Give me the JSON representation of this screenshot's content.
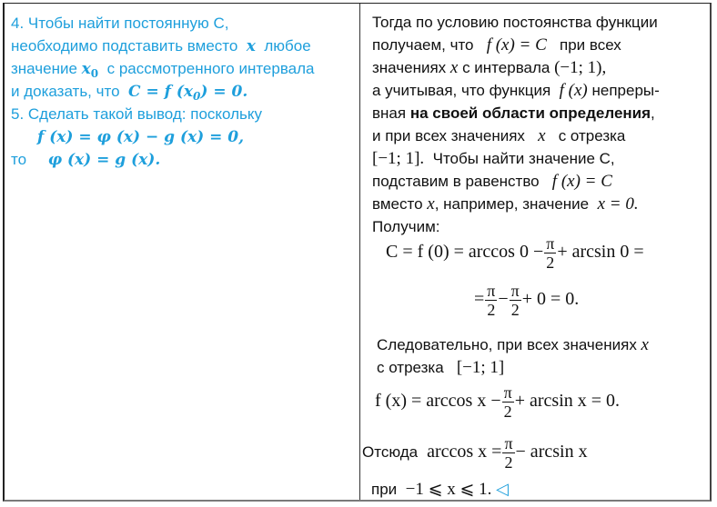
{
  "left_column": {
    "step4_line1": "4. Чтобы найти постоянную С,",
    "step4_line2_text": "необходимо подставить вместо",
    "step4_line2_var": "x",
    "step4_line2_end": "любое",
    "step4_line3_text": "значение",
    "step4_line3_var": "x",
    "step4_line3_sub": "0",
    "step4_line3_end": "с рассмотренного интервала",
    "step4_line4_text": "и доказать, что",
    "step4_line4_formula_pre": "C = f (x",
    "step4_line4_formula_sub": "0",
    "step4_line4_formula_post": ") = 0.",
    "step5_line1": "5. Сделать такой вывод: поскольку",
    "step5_formula1": "f (x) = φ (x) − g (x) = 0,",
    "step5_line3_text": "то",
    "step5_formula2": "φ (x) = g (x).",
    "text_color": "#1e9fdc"
  },
  "right_column": {
    "l1": "Тогда по условию постоянства функции",
    "l2_text": "получаем, что",
    "l2_formula": "f (x) = C",
    "l2_end": "при всех",
    "l3_text": "значениях",
    "l3_var": "x",
    "l3_mid": "с интервала",
    "l3_formula": "(−1;   1),",
    "l4_text": "а учитывая, что функция",
    "l4_formula": "f (x)",
    "l4_end": "непреры-",
    "l5_text": "вная",
    "l5_bold": "на своей области определения",
    "l5_end": ",",
    "l6_text": "и при всех значениях",
    "l6_var": "x",
    "l6_end": "с отрезка",
    "l7_formula": "[−1; 1].",
    "l7_text": "Чтобы найти значение С,",
    "l8_text": "подставим в равенство",
    "l8_formula": "f (x) = C",
    "l9_text": "вместо",
    "l9_var": "x",
    "l9_mid": ", например, значение",
    "l9_formula": "x = 0.",
    "l10_text": "Получим:",
    "eq1_lhs": "C = f  (0) = arccos 0 −",
    "eq1_frac_num": "π",
    "eq1_frac_den": "2",
    "eq1_rhs": "+ arcsin  0 =",
    "eq2_lhs": "=",
    "eq2_frac1_num": "π",
    "eq2_frac1_den": "2",
    "eq2_minus": "−",
    "eq2_frac2_num": "π",
    "eq2_frac2_den": "2",
    "eq2_rhs": "+ 0 = 0.",
    "l11_text": "Следовательно, при всех значениях",
    "l11_var": "x",
    "l12_text": "с отрезка",
    "l12_formula": "[−1; 1]",
    "eq3_lhs": "f  (x) = arccos  x −",
    "eq3_frac_num": "π",
    "eq3_frac_den": "2",
    "eq3_rhs": "+ arcsin  x = 0.",
    "l13_text": "Отсюда",
    "eq4_lhs": "arccos  x =",
    "eq4_frac_num": "π",
    "eq4_frac_den": "2",
    "eq4_rhs": "− arcsin  x",
    "l14_text": "при",
    "l14_formula": "−1 ⩽ x ⩽ 1.",
    "end_marker": "◁",
    "end_marker_icon": "triangle-left-icon"
  }
}
